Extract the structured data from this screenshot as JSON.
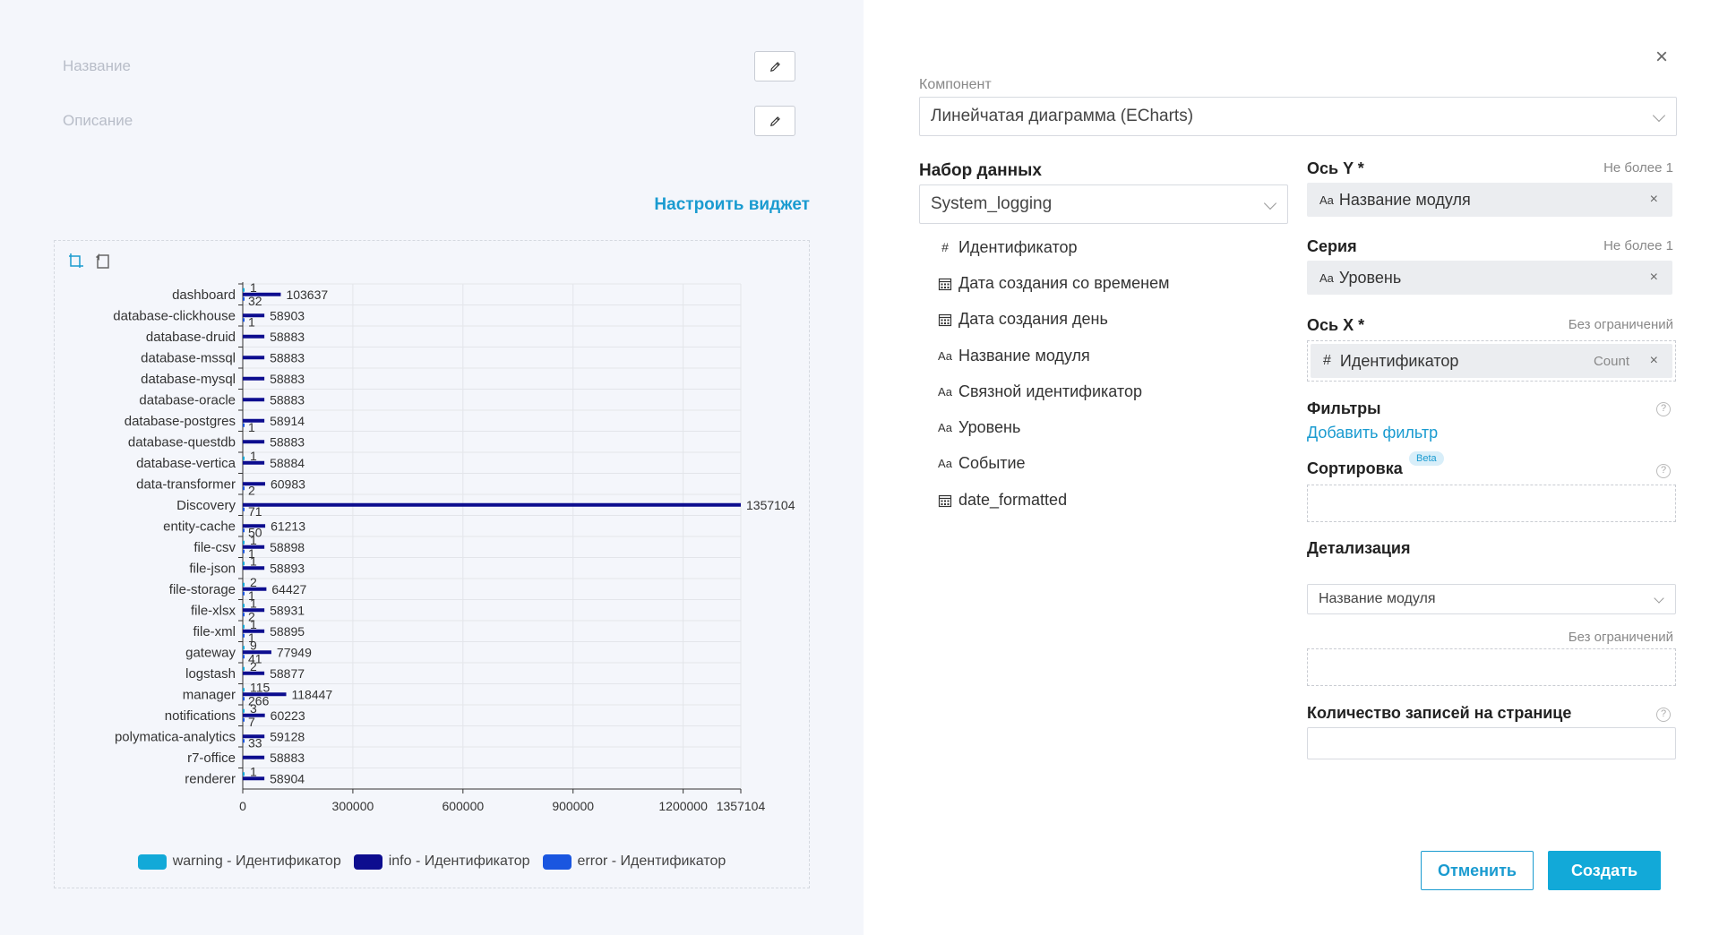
{
  "widget": {
    "name_label": "Название",
    "description_label": "Описание",
    "configure_link": "Настроить виджет"
  },
  "chart_data": {
    "type": "bar",
    "orientation": "horizontal",
    "categories": [
      "dashboard",
      "database-clickhouse",
      "database-druid",
      "database-mssql",
      "database-mysql",
      "database-oracle",
      "database-postgres",
      "database-questdb",
      "database-vertica",
      "data-transformer",
      "Discovery",
      "entity-cache",
      "file-csv",
      "file-json",
      "file-storage",
      "file-xlsx",
      "file-xml",
      "gateway",
      "logstash",
      "manager",
      "notifications",
      "polymatica-analytics",
      "r7-office",
      "renderer"
    ],
    "series": [
      {
        "name": "warning - Идентификатор",
        "color": "#12a9d8",
        "values": [
          1,
          0,
          0,
          0,
          0,
          0,
          0,
          0,
          1,
          0,
          0,
          0,
          1,
          1,
          2,
          1,
          1,
          9,
          2,
          115,
          3,
          0,
          0,
          1
        ],
        "labels": [
          "1",
          "",
          "",
          "",
          "",
          "",
          "",
          "",
          "1",
          "",
          "",
          "",
          "1",
          "1",
          "2",
          "1",
          "1",
          "9",
          "2",
          "115",
          "3",
          "",
          "",
          "1"
        ]
      },
      {
        "name": "info - Идентификатор",
        "color": "#0d0d8f",
        "values": [
          103637,
          58903,
          58883,
          58883,
          58883,
          58883,
          58914,
          58883,
          58884,
          60983,
          1357104,
          61213,
          58898,
          58893,
          64427,
          58931,
          58895,
          77949,
          58877,
          118447,
          60223,
          59128,
          58883,
          58904
        ],
        "labels": [
          "103637",
          "58903",
          "58883",
          "58883",
          "58883",
          "58883",
          "58914",
          "58883",
          "58884",
          "60983",
          "1357104",
          "61213",
          "58898",
          "58893",
          "64427",
          "58931",
          "58895",
          "77949",
          "58877",
          "118447",
          "60223",
          "59128",
          "58883",
          "58904"
        ]
      },
      {
        "name": "error - Идентификатор",
        "color": "#1a56e0",
        "values": [
          32,
          1,
          0,
          0,
          0,
          0,
          1,
          0,
          0,
          2,
          71,
          50,
          1,
          0,
          1,
          2,
          1,
          41,
          0,
          266,
          7,
          33,
          0,
          0
        ],
        "labels": [
          "32",
          "1",
          "",
          "",
          "",
          "",
          "1",
          "",
          "",
          "2",
          "71",
          "50",
          "1",
          "",
          "1",
          "2",
          "1",
          "41",
          "",
          "266",
          "7",
          "33",
          "",
          ""
        ]
      }
    ],
    "x_ticks": [
      "0",
      "300000",
      "600000",
      "900000",
      "1200000",
      "1357104"
    ],
    "x_tick_values": [
      0,
      300000,
      600000,
      900000,
      1200000,
      1357104
    ],
    "xlim": [
      0,
      1357104
    ],
    "grid": true,
    "legend_position": "bottom"
  },
  "legend": [
    {
      "label": "warning - Идентификатор",
      "color": "#12a9d8"
    },
    {
      "label": "info - Идентификатор",
      "color": "#0d0d8f"
    },
    {
      "label": "error - Идентификатор",
      "color": "#1a56e0"
    }
  ],
  "config": {
    "component_label": "Компонент",
    "component_value": "Линейчатая диаграмма (ECharts)",
    "dataset_title": "Набор данных",
    "dataset_value": "System_logging",
    "fields": [
      {
        "icon": "#",
        "type": "number",
        "label": "Идентификатор"
      },
      {
        "icon": "calendar",
        "type": "date",
        "label": "Дата создания со временем"
      },
      {
        "icon": "calendar",
        "type": "date",
        "label": "Дата создания день"
      },
      {
        "icon": "Aa",
        "type": "text",
        "label": "Название модуля"
      },
      {
        "icon": "Aa",
        "type": "text",
        "label": "Связной идентификатор"
      },
      {
        "icon": "Aa",
        "type": "text",
        "label": "Уровень"
      },
      {
        "icon": "Aa",
        "type": "text",
        "label": "Событие"
      },
      {
        "icon": "calendar",
        "type": "date",
        "label": "date_formatted"
      }
    ],
    "y_axis": {
      "title": "Ось Y *",
      "limit": "Не более 1",
      "chip_icon": "Aa",
      "chip": "Название модуля"
    },
    "series": {
      "title": "Серия",
      "limit": "Не более 1",
      "chip_icon": "Aa",
      "chip": "Уровень"
    },
    "x_axis": {
      "title": "Ось X *",
      "limit": "Без ограничений",
      "chip_icon": "#",
      "chip": "Идентификатор",
      "agg": "Count"
    },
    "filters": {
      "title": "Фильтры",
      "add": "Добавить фильтр"
    },
    "sorting": {
      "title": "Сортировка",
      "badge": "Beta"
    },
    "detail": {
      "title": "Детализация",
      "select": "Название модуля",
      "limit": "Без ограничений"
    },
    "page_size": {
      "title": "Количество записей на странице",
      "value": ""
    },
    "chip_remove": "×",
    "help": "?",
    "close": "×"
  },
  "buttons": {
    "cancel": "Отменить",
    "create": "Создать"
  }
}
